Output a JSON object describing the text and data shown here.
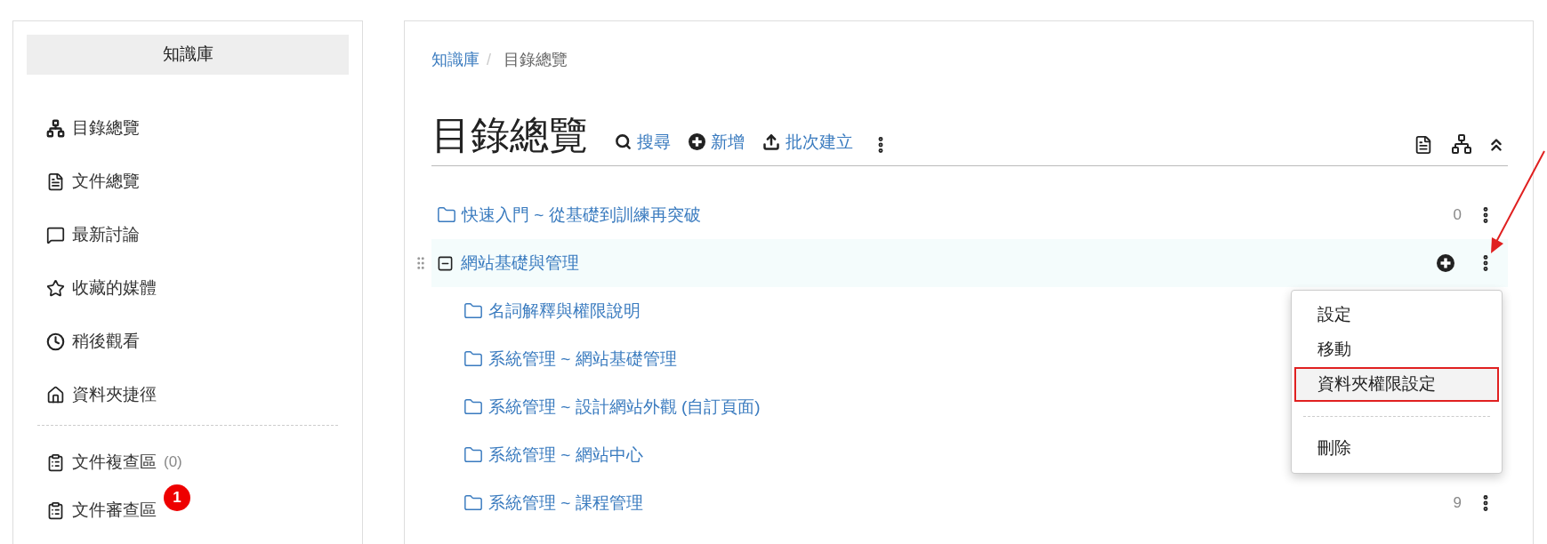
{
  "sidebar": {
    "title": "知識庫",
    "items": [
      {
        "kind": "tree",
        "label": "目錄總覽"
      },
      {
        "kind": "file",
        "label": "文件總覽"
      },
      {
        "kind": "discussion",
        "label": "最新討論"
      },
      {
        "kind": "star",
        "label": "收藏的媒體"
      },
      {
        "kind": "clock",
        "label": "稍後觀看"
      },
      {
        "kind": "home",
        "label": "資料夾捷徑"
      }
    ],
    "review_items": [
      {
        "kind": "clipboard",
        "label": "文件複查區",
        "count": "(0)"
      },
      {
        "kind": "clipboard",
        "label": "文件審查區",
        "badge": "1"
      }
    ]
  },
  "breadcrumb": [
    {
      "kind": "link",
      "label": "知識庫"
    },
    {
      "kind": "separator",
      "label": "/"
    },
    {
      "kind": "current",
      "label": "目錄總覽"
    }
  ],
  "page_title": "目錄總覽",
  "toolbar": [
    {
      "kind": "search",
      "label": "搜尋"
    },
    {
      "kind": "plus",
      "label": "新增"
    },
    {
      "kind": "upload",
      "label": "批次建立"
    }
  ],
  "tree": [
    {
      "label": "快速入門 ~ 從基礎到訓練再突破",
      "expanded": false,
      "selected": false,
      "count": "0",
      "more": true
    },
    {
      "label": "網站基礎與管理",
      "expanded": true,
      "selected": true,
      "more": true,
      "children": [
        {
          "label": "名詞解釋與權限說明",
          "selected": false,
          "more": false
        },
        {
          "label": "系統管理 ~ 網站基礎管理",
          "selected": false,
          "more": false
        },
        {
          "label": "系統管理 ~ 設計網站外觀 (自訂頁面)",
          "selected": false,
          "more": false
        },
        {
          "label": "系統管理 ~ 網站中心",
          "selected": false,
          "more": false
        },
        {
          "label": "系統管理 ~ 課程管理",
          "selected": false,
          "count": "9",
          "more": true
        }
      ]
    }
  ],
  "context_menu": [
    {
      "label": "設定",
      "highlighted": false
    },
    {
      "label": "移動",
      "highlighted": false
    },
    {
      "label": "資料夾權限設定",
      "highlighted": true
    },
    {
      "kind": "divider"
    },
    {
      "label": "刪除",
      "highlighted": false
    }
  ]
}
